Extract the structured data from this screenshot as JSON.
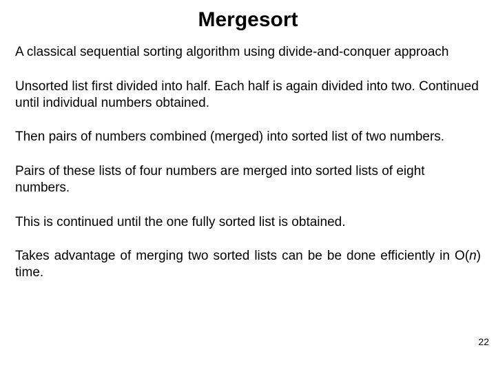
{
  "title": "Mergesort",
  "p1": "A classical sequential sorting algorithm using divide-and-conquer approach",
  "p2": "Unsorted list first divided into half. Each half is again divided into two. Continued until individual numbers obtained.",
  "p3": "Then pairs of numbers combined (merged) into sorted list of two numbers.",
  "p4": "Pairs of these lists of four numbers are merged into sorted lists of eight numbers.",
  "p5": "This is continued until the one fully sorted list is obtained.",
  "p6_pre": "Takes advantage of merging two sorted lists can be be done efficiently in O(",
  "p6_n": "n",
  "p6_post": ") time.",
  "page_number": "22"
}
